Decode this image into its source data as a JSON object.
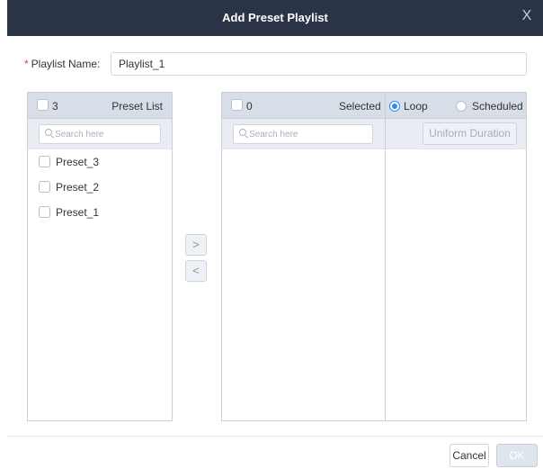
{
  "dialog": {
    "title": "Add Preset Playlist",
    "close_glyph": "X"
  },
  "playlist_name": {
    "required_mark": "*",
    "label": "Playlist Name:",
    "value": "Playlist_1"
  },
  "left_panel": {
    "count": "3",
    "header": "Preset List",
    "search_placeholder": "Search here",
    "items": [
      {
        "label": "Preset_3",
        "checked": false
      },
      {
        "label": "Preset_2",
        "checked": false
      },
      {
        "label": "Preset_1",
        "checked": false
      }
    ]
  },
  "transfer": {
    "add_glyph": ">",
    "remove_glyph": "<"
  },
  "right_panel": {
    "count": "0",
    "header": "Selected",
    "search_placeholder": "Search here",
    "mode_options": [
      {
        "label": "Loop",
        "selected": true
      },
      {
        "label": "Scheduled",
        "selected": false
      }
    ],
    "uniform_duration_label": "Uniform Duration"
  },
  "footer": {
    "cancel_label": "Cancel",
    "ok_label": "OK"
  },
  "colors": {
    "titlebar_bg": "#2b3346",
    "accent": "#2d8cf0",
    "required": "#e5414a",
    "panel_header_bg": "#d8dee8"
  }
}
